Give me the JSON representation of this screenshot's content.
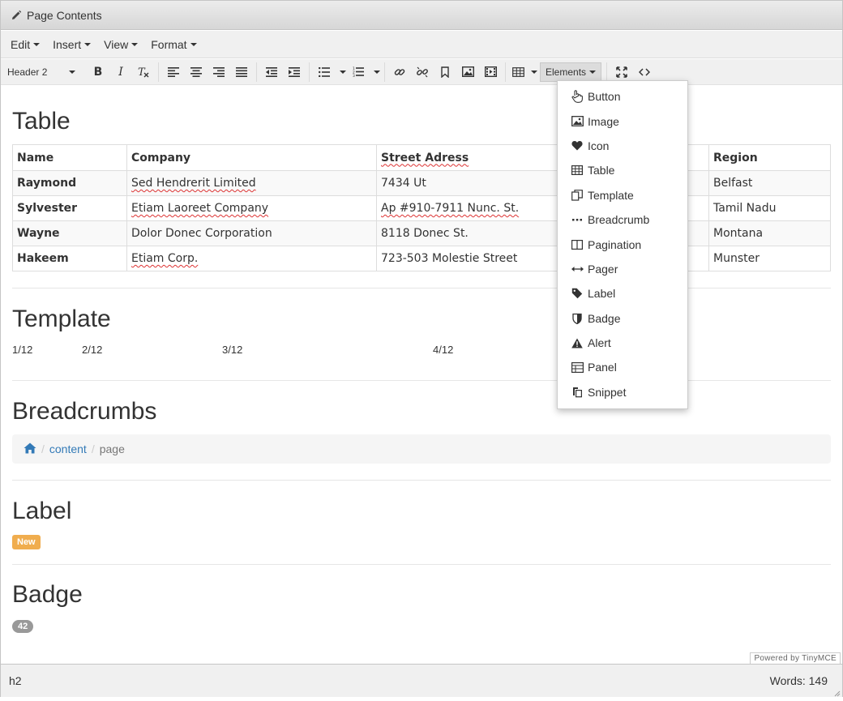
{
  "window": {
    "title": "Page Contents"
  },
  "menubar": {
    "items": [
      {
        "label": "Edit"
      },
      {
        "label": "Insert"
      },
      {
        "label": "View"
      },
      {
        "label": "Format"
      }
    ]
  },
  "toolbar": {
    "block_format": "Header 2",
    "elements_label": "Elements"
  },
  "elements_menu": {
    "items": [
      {
        "label": "Button",
        "icon": "pointer-hand-icon"
      },
      {
        "label": "Image",
        "icon": "image-icon"
      },
      {
        "label": "Icon",
        "icon": "heart-icon"
      },
      {
        "label": "Table",
        "icon": "table-icon"
      },
      {
        "label": "Template",
        "icon": "template-icon"
      },
      {
        "label": "Breadcrumb",
        "icon": "ellipsis-icon"
      },
      {
        "label": "Pagination",
        "icon": "columns-icon"
      },
      {
        "label": "Pager",
        "icon": "arrows-horizontal-icon"
      },
      {
        "label": "Label",
        "icon": "tag-icon"
      },
      {
        "label": "Badge",
        "icon": "shield-icon"
      },
      {
        "label": "Alert",
        "icon": "warning-icon"
      },
      {
        "label": "Panel",
        "icon": "panel-icon"
      },
      {
        "label": "Snippet",
        "icon": "copy-icon"
      }
    ]
  },
  "content": {
    "table_heading": "Table",
    "table": {
      "headers": [
        "Name",
        "Company",
        "Street Adress",
        "",
        "Region"
      ],
      "rows": [
        [
          "Raymond",
          "Sed Hendrerit Limited",
          "7434 Ut",
          "",
          "Belfast"
        ],
        [
          "Sylvester",
          "Etiam Laoreet Company",
          "Ap #910-7911 Nunc. St.",
          "",
          "Tamil Nadu"
        ],
        [
          "Wayne",
          "Dolor Donec Corporation",
          "8118 Donec St.",
          "",
          "Montana"
        ],
        [
          "Hakeem",
          "Etiam Corp.",
          "723-503 Molestie Street",
          "",
          "Munster"
        ]
      ]
    },
    "template_heading": "Template",
    "template_cols": [
      "1/12",
      "2/12",
      "3/12",
      "4/12"
    ],
    "breadcrumbs_heading": "Breadcrumbs",
    "breadcrumb": {
      "link": "content",
      "separator": "/",
      "active": "page"
    },
    "label_heading": "Label",
    "label_text": "New",
    "badge_heading": "Badge",
    "badge_value": "42"
  },
  "branding": "Powered by TinyMCE",
  "statusbar": {
    "path": "h2",
    "word_count": "Words: 149"
  },
  "colors": {
    "link": "#337ab7",
    "label_warning": "#f0ad4e",
    "badge": "#999999"
  }
}
